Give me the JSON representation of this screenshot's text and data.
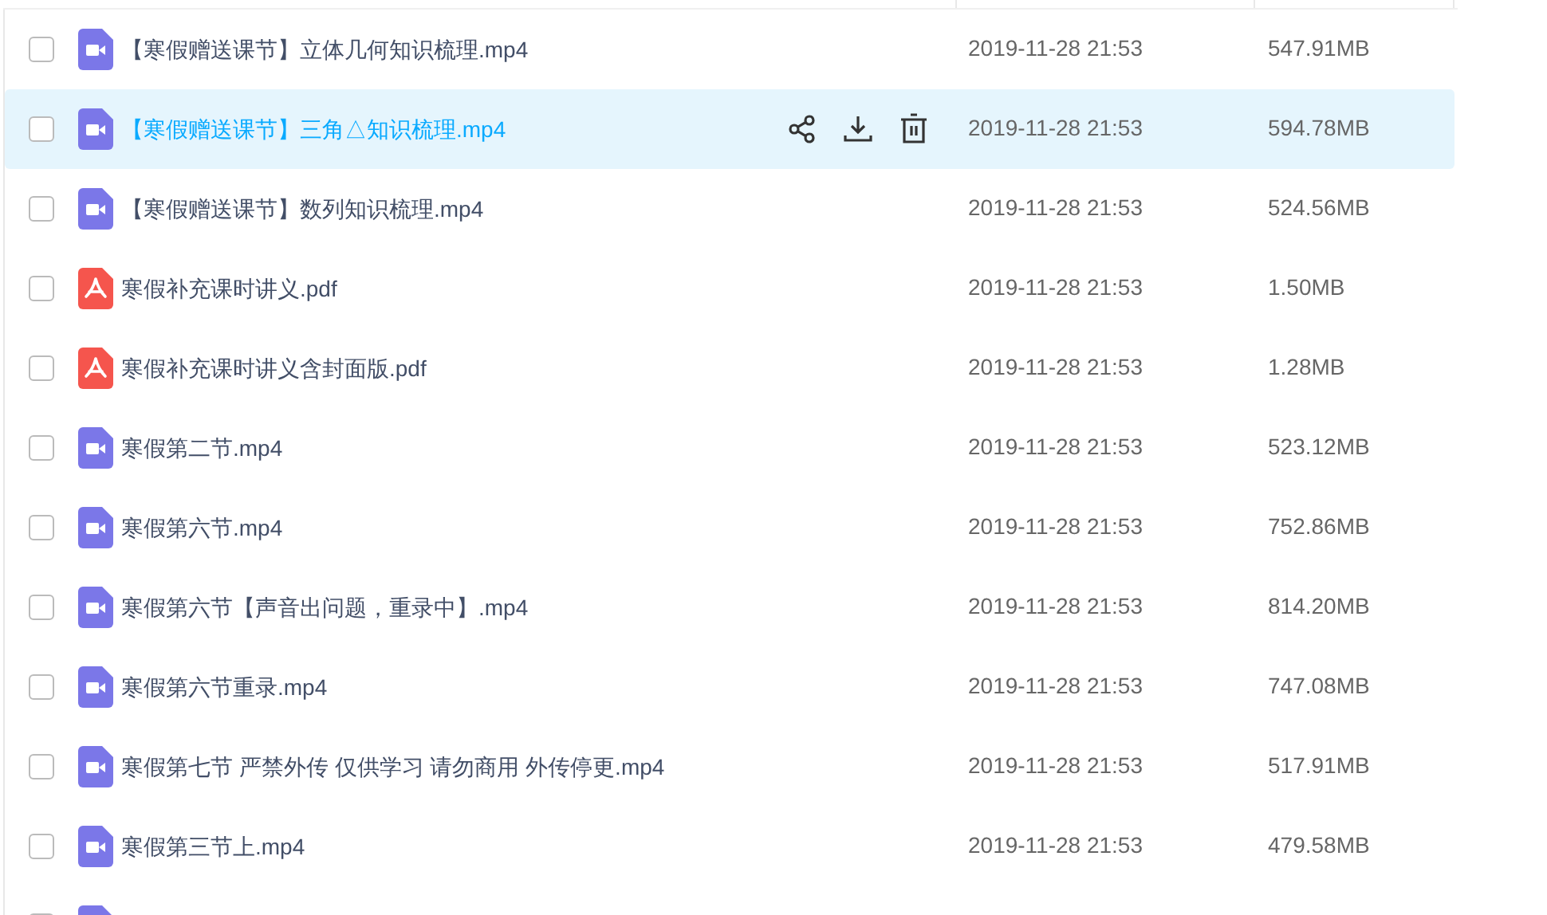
{
  "files": [
    {
      "kind": "video",
      "name": "【寒假赠送课节】立体几何知识梳理.mp4",
      "modified": "2019-11-28 21:53",
      "size": "547.91MB",
      "selected": false,
      "checked": false
    },
    {
      "kind": "video",
      "name": "【寒假赠送课节】三角△知识梳理.mp4",
      "modified": "2019-11-28 21:53",
      "size": "594.78MB",
      "selected": true,
      "checked": false
    },
    {
      "kind": "video",
      "name": "【寒假赠送课节】数列知识梳理.mp4",
      "modified": "2019-11-28 21:53",
      "size": "524.56MB",
      "selected": false,
      "checked": false
    },
    {
      "kind": "pdf",
      "name": "寒假补充课时讲义.pdf",
      "modified": "2019-11-28 21:53",
      "size": "1.50MB",
      "selected": false,
      "checked": false
    },
    {
      "kind": "pdf",
      "name": "寒假补充课时讲义含封面版.pdf",
      "modified": "2019-11-28 21:53",
      "size": "1.28MB",
      "selected": false,
      "checked": false
    },
    {
      "kind": "video",
      "name": "寒假第二节.mp4",
      "modified": "2019-11-28 21:53",
      "size": "523.12MB",
      "selected": false,
      "checked": false
    },
    {
      "kind": "video",
      "name": "寒假第六节.mp4",
      "modified": "2019-11-28 21:53",
      "size": "752.86MB",
      "selected": false,
      "checked": false
    },
    {
      "kind": "video",
      "name": "寒假第六节【声音出问题，重录中】.mp4",
      "modified": "2019-11-28 21:53",
      "size": "814.20MB",
      "selected": false,
      "checked": false
    },
    {
      "kind": "video",
      "name": "寒假第六节重录.mp4",
      "modified": "2019-11-28 21:53",
      "size": "747.08MB",
      "selected": false,
      "checked": false
    },
    {
      "kind": "video",
      "name": "寒假第七节 严禁外传 仅供学习 请勿商用 外传停更.mp4",
      "modified": "2019-11-28 21:53",
      "size": "517.91MB",
      "selected": false,
      "checked": false
    },
    {
      "kind": "video",
      "name": "寒假第三节上.mp4",
      "modified": "2019-11-28 21:53",
      "size": "479.58MB",
      "selected": false,
      "checked": false
    },
    {
      "kind": "video",
      "selected": false,
      "checked": false
    }
  ]
}
